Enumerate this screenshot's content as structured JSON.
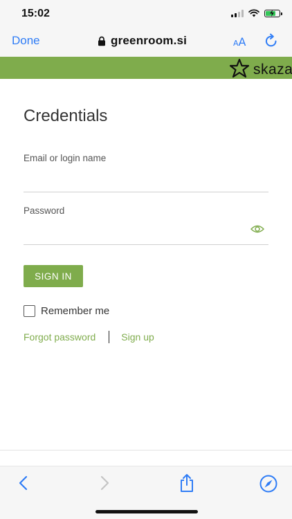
{
  "status_bar": {
    "time": "15:02",
    "signal_bars_active": 2,
    "signal_bars_total": 4,
    "battery_level": 0.8,
    "battery_color": "#34c759",
    "icons": [
      "signal-icon",
      "wifi-icon",
      "battery-charging-icon"
    ]
  },
  "browser": {
    "done_label": "Done",
    "url": "greenroom.si",
    "text_size_small": "A",
    "text_size_big": "A",
    "accent_color": "#2e7cf6",
    "icons": [
      "lock-icon",
      "text-size-icon",
      "reload-icon",
      "back-icon",
      "forward-icon",
      "share-icon",
      "compass-icon"
    ]
  },
  "site_header": {
    "brand_color": "#7fac4c",
    "logo_text": "skaza"
  },
  "login": {
    "title": "Credentials",
    "email_label": "Email or login name",
    "email_value": "",
    "password_label": "Password",
    "password_value": "",
    "sign_in_label": "SIGN IN",
    "remember_label": "Remember me",
    "remember_checked": false,
    "forgot_link": "Forgot password",
    "signup_link": "Sign up"
  }
}
